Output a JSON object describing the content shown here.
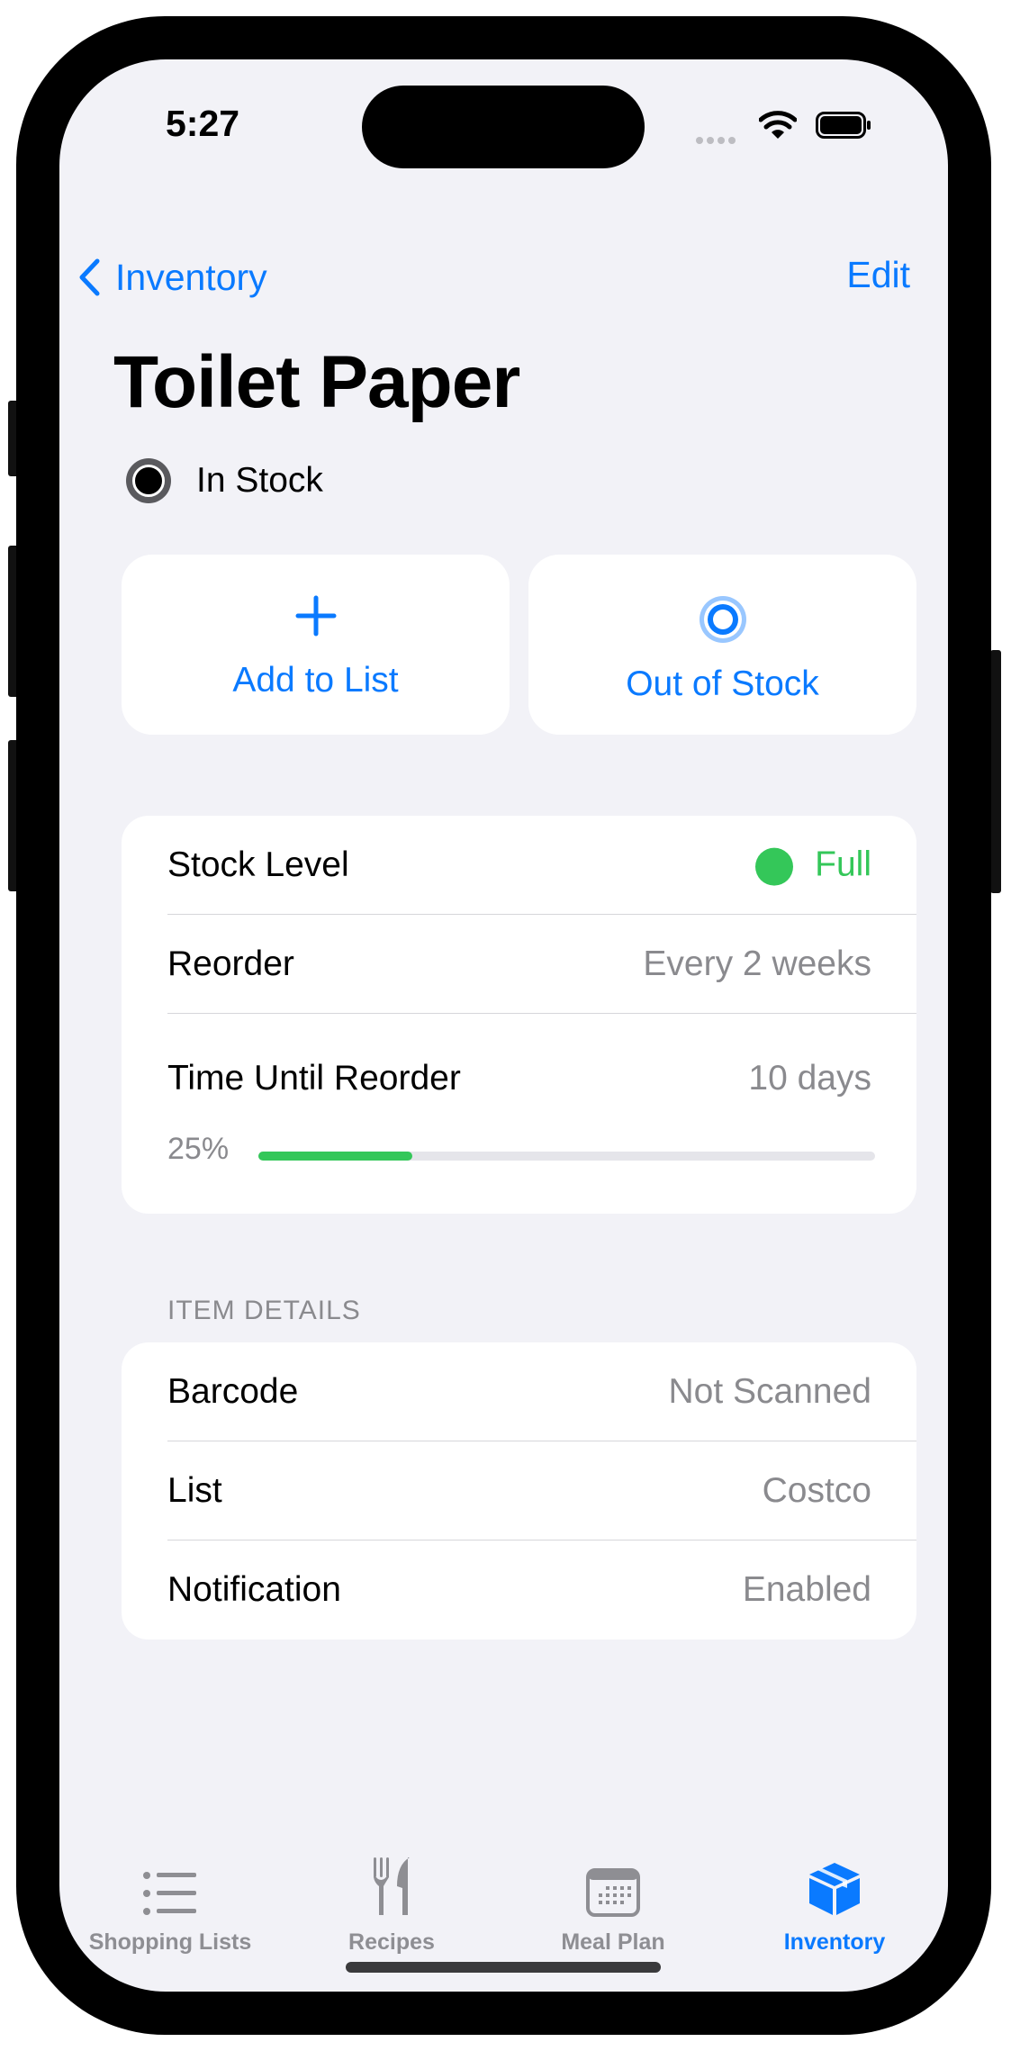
{
  "status_bar": {
    "time": "5:27"
  },
  "nav": {
    "back_label": "Inventory",
    "edit_label": "Edit"
  },
  "item": {
    "title": "Toilet Paper",
    "status": "In Stock"
  },
  "actions": [
    {
      "label": "Add to List",
      "icon": "plus-icon"
    },
    {
      "label": "Out of Stock",
      "icon": "target-icon"
    }
  ],
  "stock": {
    "stock_level_label": "Stock Level",
    "stock_level_value": "Full",
    "reorder_label": "Reorder",
    "reorder_value": "Every 2 weeks",
    "time_until_label": "Time Until Reorder",
    "time_until_value": "10 days",
    "progress_text": "25%",
    "progress": 0.25
  },
  "details": {
    "header": "ITEM DETAILS",
    "rows": [
      {
        "label": "Barcode",
        "value": "Not Scanned"
      },
      {
        "label": "List",
        "value": "Costco"
      },
      {
        "label": "Notification",
        "value": "Enabled"
      }
    ]
  },
  "tabs": [
    {
      "label": "Shopping Lists",
      "icon": "list-icon",
      "active": false
    },
    {
      "label": "Recipes",
      "icon": "fork-knife-icon",
      "active": false
    },
    {
      "label": "Meal Plan",
      "icon": "calendar-icon",
      "active": false
    },
    {
      "label": "Inventory",
      "icon": "box-icon",
      "active": true
    }
  ],
  "colors": {
    "accent": "#0a7aff",
    "success": "#34c759",
    "background": "#f2f2f7"
  }
}
